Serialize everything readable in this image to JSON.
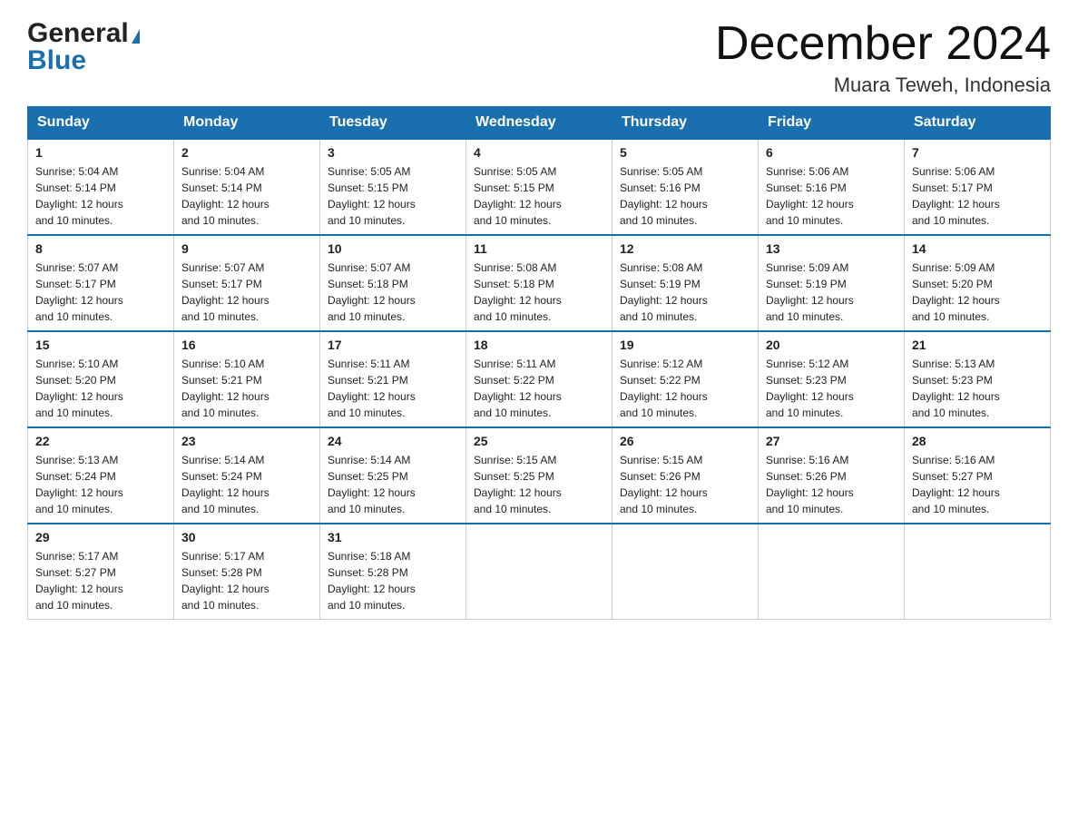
{
  "header": {
    "logo_general": "General",
    "logo_blue": "Blue",
    "month_title": "December 2024",
    "location": "Muara Teweh, Indonesia"
  },
  "days_of_week": [
    "Sunday",
    "Monday",
    "Tuesday",
    "Wednesday",
    "Thursday",
    "Friday",
    "Saturday"
  ],
  "weeks": [
    [
      {
        "day": "1",
        "sunrise": "5:04 AM",
        "sunset": "5:14 PM",
        "daylight": "12 hours and 10 minutes."
      },
      {
        "day": "2",
        "sunrise": "5:04 AM",
        "sunset": "5:14 PM",
        "daylight": "12 hours and 10 minutes."
      },
      {
        "day": "3",
        "sunrise": "5:05 AM",
        "sunset": "5:15 PM",
        "daylight": "12 hours and 10 minutes."
      },
      {
        "day": "4",
        "sunrise": "5:05 AM",
        "sunset": "5:15 PM",
        "daylight": "12 hours and 10 minutes."
      },
      {
        "day": "5",
        "sunrise": "5:05 AM",
        "sunset": "5:16 PM",
        "daylight": "12 hours and 10 minutes."
      },
      {
        "day": "6",
        "sunrise": "5:06 AM",
        "sunset": "5:16 PM",
        "daylight": "12 hours and 10 minutes."
      },
      {
        "day": "7",
        "sunrise": "5:06 AM",
        "sunset": "5:17 PM",
        "daylight": "12 hours and 10 minutes."
      }
    ],
    [
      {
        "day": "8",
        "sunrise": "5:07 AM",
        "sunset": "5:17 PM",
        "daylight": "12 hours and 10 minutes."
      },
      {
        "day": "9",
        "sunrise": "5:07 AM",
        "sunset": "5:17 PM",
        "daylight": "12 hours and 10 minutes."
      },
      {
        "day": "10",
        "sunrise": "5:07 AM",
        "sunset": "5:18 PM",
        "daylight": "12 hours and 10 minutes."
      },
      {
        "day": "11",
        "sunrise": "5:08 AM",
        "sunset": "5:18 PM",
        "daylight": "12 hours and 10 minutes."
      },
      {
        "day": "12",
        "sunrise": "5:08 AM",
        "sunset": "5:19 PM",
        "daylight": "12 hours and 10 minutes."
      },
      {
        "day": "13",
        "sunrise": "5:09 AM",
        "sunset": "5:19 PM",
        "daylight": "12 hours and 10 minutes."
      },
      {
        "day": "14",
        "sunrise": "5:09 AM",
        "sunset": "5:20 PM",
        "daylight": "12 hours and 10 minutes."
      }
    ],
    [
      {
        "day": "15",
        "sunrise": "5:10 AM",
        "sunset": "5:20 PM",
        "daylight": "12 hours and 10 minutes."
      },
      {
        "day": "16",
        "sunrise": "5:10 AM",
        "sunset": "5:21 PM",
        "daylight": "12 hours and 10 minutes."
      },
      {
        "day": "17",
        "sunrise": "5:11 AM",
        "sunset": "5:21 PM",
        "daylight": "12 hours and 10 minutes."
      },
      {
        "day": "18",
        "sunrise": "5:11 AM",
        "sunset": "5:22 PM",
        "daylight": "12 hours and 10 minutes."
      },
      {
        "day": "19",
        "sunrise": "5:12 AM",
        "sunset": "5:22 PM",
        "daylight": "12 hours and 10 minutes."
      },
      {
        "day": "20",
        "sunrise": "5:12 AM",
        "sunset": "5:23 PM",
        "daylight": "12 hours and 10 minutes."
      },
      {
        "day": "21",
        "sunrise": "5:13 AM",
        "sunset": "5:23 PM",
        "daylight": "12 hours and 10 minutes."
      }
    ],
    [
      {
        "day": "22",
        "sunrise": "5:13 AM",
        "sunset": "5:24 PM",
        "daylight": "12 hours and 10 minutes."
      },
      {
        "day": "23",
        "sunrise": "5:14 AM",
        "sunset": "5:24 PM",
        "daylight": "12 hours and 10 minutes."
      },
      {
        "day": "24",
        "sunrise": "5:14 AM",
        "sunset": "5:25 PM",
        "daylight": "12 hours and 10 minutes."
      },
      {
        "day": "25",
        "sunrise": "5:15 AM",
        "sunset": "5:25 PM",
        "daylight": "12 hours and 10 minutes."
      },
      {
        "day": "26",
        "sunrise": "5:15 AM",
        "sunset": "5:26 PM",
        "daylight": "12 hours and 10 minutes."
      },
      {
        "day": "27",
        "sunrise": "5:16 AM",
        "sunset": "5:26 PM",
        "daylight": "12 hours and 10 minutes."
      },
      {
        "day": "28",
        "sunrise": "5:16 AM",
        "sunset": "5:27 PM",
        "daylight": "12 hours and 10 minutes."
      }
    ],
    [
      {
        "day": "29",
        "sunrise": "5:17 AM",
        "sunset": "5:27 PM",
        "daylight": "12 hours and 10 minutes."
      },
      {
        "day": "30",
        "sunrise": "5:17 AM",
        "sunset": "5:28 PM",
        "daylight": "12 hours and 10 minutes."
      },
      {
        "day": "31",
        "sunrise": "5:18 AM",
        "sunset": "5:28 PM",
        "daylight": "12 hours and 10 minutes."
      },
      null,
      null,
      null,
      null
    ]
  ],
  "labels": {
    "sunrise": "Sunrise:",
    "sunset": "Sunset:",
    "daylight": "Daylight: 12 hours"
  }
}
